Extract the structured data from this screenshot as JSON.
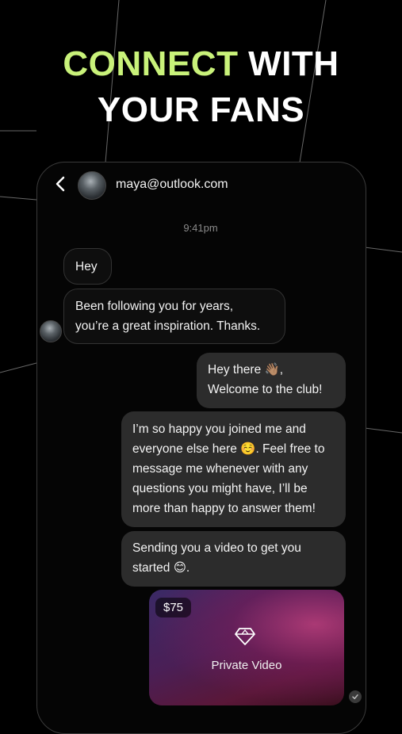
{
  "headline": {
    "accent": "CONNECT",
    "rest_line1": " WITH",
    "line2": "YOUR FANS"
  },
  "colors": {
    "accent": "#c9f27a",
    "background": "#000000",
    "outgoing_bubble": "#2c2c2c"
  },
  "chat": {
    "contact": "maya@outlook.com",
    "timestamp": "9:41pm",
    "messages": [
      {
        "from": "them",
        "lines": [
          "Hey"
        ]
      },
      {
        "from": "them",
        "lines": [
          "Been following you for years,",
          "you’re a great inspiration. Thanks."
        ]
      },
      {
        "from": "me",
        "lines": [
          "Hey there 👋🏽,",
          "Welcome to the club!"
        ]
      },
      {
        "from": "me",
        "lines": [
          "I’m so happy you joined me and",
          "everyone else here ☺️. Feel free to",
          "message me whenever with any",
          "questions you might have, I’ll be",
          "more than happy to answer them!"
        ]
      },
      {
        "from": "me",
        "lines": [
          "Sending you a video to get you",
          "started 😊."
        ]
      }
    ],
    "video": {
      "price": "$75",
      "label": "Private Video",
      "icon": "diamond-icon"
    }
  },
  "icons": {
    "back": "chevron-left-icon",
    "read": "check-circle-icon"
  }
}
